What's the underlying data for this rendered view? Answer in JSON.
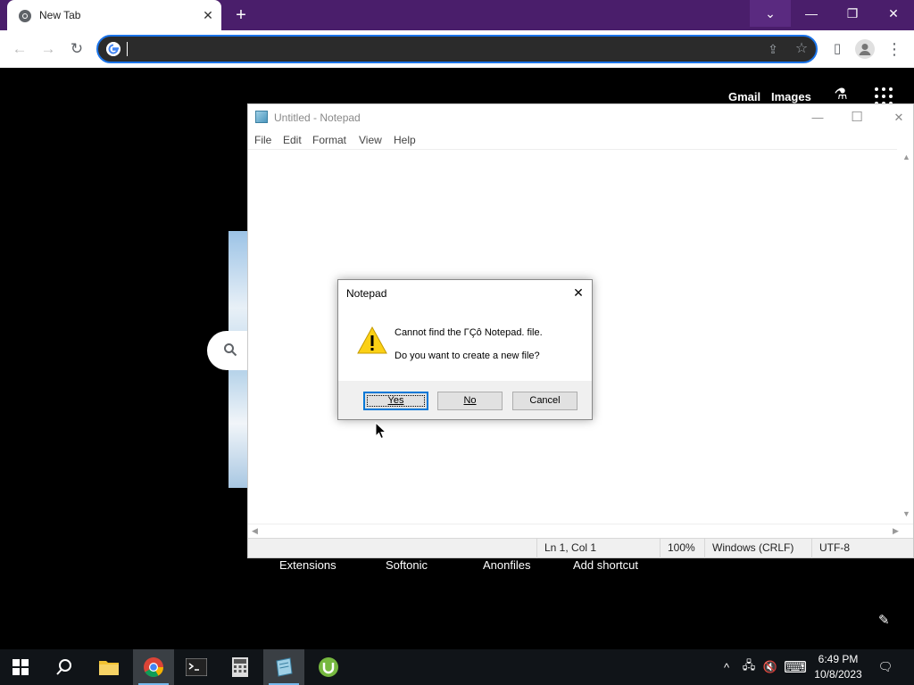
{
  "browser": {
    "tab_title": "New Tab",
    "tab_close": "✕",
    "new_tab": "+",
    "window_buttons": {
      "tab_search": "⌄",
      "minimize": "—",
      "restore": "❐",
      "close": "✕"
    },
    "nav": {
      "back": "←",
      "forward": "→",
      "reload": "↻"
    },
    "omnibox": {
      "value": "",
      "placeholder": ""
    },
    "toolbar_icons": {
      "share": "⇪",
      "star": "☆",
      "sidepanel": "▯",
      "menu": "⋮"
    }
  },
  "newtab_page": {
    "links": {
      "gmail": "Gmail",
      "images": "Images"
    },
    "labs_glyph": "⚗",
    "shortcuts": [
      "Extensions",
      "Softonic",
      "Anonfiles",
      "Add shortcut"
    ],
    "customize_glyph": "✎"
  },
  "notepad": {
    "title": "Untitled - Notepad",
    "window_buttons": {
      "minimize": "—",
      "maximize": "☐",
      "close": "✕"
    },
    "menu": [
      "File",
      "Edit",
      "Format",
      "View",
      "Help"
    ],
    "status": {
      "position": "Ln 1, Col 1",
      "zoom": "100%",
      "line_endings": "Windows (CRLF)",
      "encoding": "UTF-8"
    }
  },
  "dialog": {
    "title": "Notepad",
    "close": "✕",
    "message_line1": "Cannot find the ΓÇô Notepad. file.",
    "message_line2": "Do you want to create a new file?",
    "buttons": {
      "yes": "Yes",
      "no": "No",
      "cancel": "Cancel"
    }
  },
  "taskbar": {
    "apps": [
      "start",
      "search",
      "file-explorer",
      "chrome",
      "terminal",
      "calculator",
      "notepad",
      "utorrent"
    ],
    "clock_time": "6:49 PM",
    "clock_date": "10/8/2023",
    "tray": {
      "chevron": "^",
      "network": "🖧",
      "volume": "🔇",
      "keyboard": "⌨",
      "notifications": "🗨"
    }
  }
}
